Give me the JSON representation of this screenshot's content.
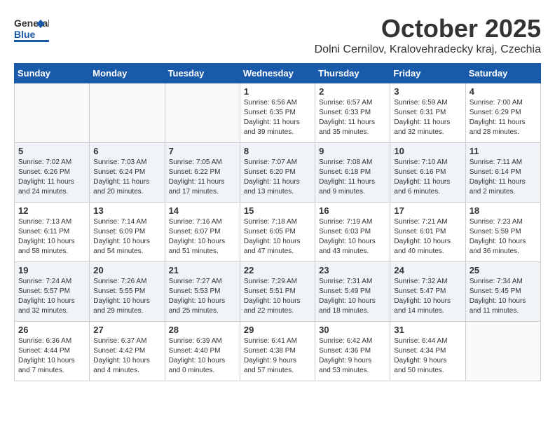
{
  "header": {
    "logo": {
      "general": "General",
      "blue": "Blue"
    },
    "title": "October 2025",
    "location": "Dolni Cernilov, Kralovehradecky kraj, Czechia"
  },
  "calendar": {
    "days_of_week": [
      "Sunday",
      "Monday",
      "Tuesday",
      "Wednesday",
      "Thursday",
      "Friday",
      "Saturday"
    ],
    "weeks": [
      [
        {
          "day": "",
          "info": ""
        },
        {
          "day": "",
          "info": ""
        },
        {
          "day": "",
          "info": ""
        },
        {
          "day": "1",
          "info": "Sunrise: 6:56 AM\nSunset: 6:35 PM\nDaylight: 11 hours\nand 39 minutes."
        },
        {
          "day": "2",
          "info": "Sunrise: 6:57 AM\nSunset: 6:33 PM\nDaylight: 11 hours\nand 35 minutes."
        },
        {
          "day": "3",
          "info": "Sunrise: 6:59 AM\nSunset: 6:31 PM\nDaylight: 11 hours\nand 32 minutes."
        },
        {
          "day": "4",
          "info": "Sunrise: 7:00 AM\nSunset: 6:29 PM\nDaylight: 11 hours\nand 28 minutes."
        }
      ],
      [
        {
          "day": "5",
          "info": "Sunrise: 7:02 AM\nSunset: 6:26 PM\nDaylight: 11 hours\nand 24 minutes."
        },
        {
          "day": "6",
          "info": "Sunrise: 7:03 AM\nSunset: 6:24 PM\nDaylight: 11 hours\nand 20 minutes."
        },
        {
          "day": "7",
          "info": "Sunrise: 7:05 AM\nSunset: 6:22 PM\nDaylight: 11 hours\nand 17 minutes."
        },
        {
          "day": "8",
          "info": "Sunrise: 7:07 AM\nSunset: 6:20 PM\nDaylight: 11 hours\nand 13 minutes."
        },
        {
          "day": "9",
          "info": "Sunrise: 7:08 AM\nSunset: 6:18 PM\nDaylight: 11 hours\nand 9 minutes."
        },
        {
          "day": "10",
          "info": "Sunrise: 7:10 AM\nSunset: 6:16 PM\nDaylight: 11 hours\nand 6 minutes."
        },
        {
          "day": "11",
          "info": "Sunrise: 7:11 AM\nSunset: 6:14 PM\nDaylight: 11 hours\nand 2 minutes."
        }
      ],
      [
        {
          "day": "12",
          "info": "Sunrise: 7:13 AM\nSunset: 6:11 PM\nDaylight: 10 hours\nand 58 minutes."
        },
        {
          "day": "13",
          "info": "Sunrise: 7:14 AM\nSunset: 6:09 PM\nDaylight: 10 hours\nand 54 minutes."
        },
        {
          "day": "14",
          "info": "Sunrise: 7:16 AM\nSunset: 6:07 PM\nDaylight: 10 hours\nand 51 minutes."
        },
        {
          "day": "15",
          "info": "Sunrise: 7:18 AM\nSunset: 6:05 PM\nDaylight: 10 hours\nand 47 minutes."
        },
        {
          "day": "16",
          "info": "Sunrise: 7:19 AM\nSunset: 6:03 PM\nDaylight: 10 hours\nand 43 minutes."
        },
        {
          "day": "17",
          "info": "Sunrise: 7:21 AM\nSunset: 6:01 PM\nDaylight: 10 hours\nand 40 minutes."
        },
        {
          "day": "18",
          "info": "Sunrise: 7:23 AM\nSunset: 5:59 PM\nDaylight: 10 hours\nand 36 minutes."
        }
      ],
      [
        {
          "day": "19",
          "info": "Sunrise: 7:24 AM\nSunset: 5:57 PM\nDaylight: 10 hours\nand 32 minutes."
        },
        {
          "day": "20",
          "info": "Sunrise: 7:26 AM\nSunset: 5:55 PM\nDaylight: 10 hours\nand 29 minutes."
        },
        {
          "day": "21",
          "info": "Sunrise: 7:27 AM\nSunset: 5:53 PM\nDaylight: 10 hours\nand 25 minutes."
        },
        {
          "day": "22",
          "info": "Sunrise: 7:29 AM\nSunset: 5:51 PM\nDaylight: 10 hours\nand 22 minutes."
        },
        {
          "day": "23",
          "info": "Sunrise: 7:31 AM\nSunset: 5:49 PM\nDaylight: 10 hours\nand 18 minutes."
        },
        {
          "day": "24",
          "info": "Sunrise: 7:32 AM\nSunset: 5:47 PM\nDaylight: 10 hours\nand 14 minutes."
        },
        {
          "day": "25",
          "info": "Sunrise: 7:34 AM\nSunset: 5:45 PM\nDaylight: 10 hours\nand 11 minutes."
        }
      ],
      [
        {
          "day": "26",
          "info": "Sunrise: 6:36 AM\nSunset: 4:44 PM\nDaylight: 10 hours\nand 7 minutes."
        },
        {
          "day": "27",
          "info": "Sunrise: 6:37 AM\nSunset: 4:42 PM\nDaylight: 10 hours\nand 4 minutes."
        },
        {
          "day": "28",
          "info": "Sunrise: 6:39 AM\nSunset: 4:40 PM\nDaylight: 10 hours\nand 0 minutes."
        },
        {
          "day": "29",
          "info": "Sunrise: 6:41 AM\nSunset: 4:38 PM\nDaylight: 9 hours\nand 57 minutes."
        },
        {
          "day": "30",
          "info": "Sunrise: 6:42 AM\nSunset: 4:36 PM\nDaylight: 9 hours\nand 53 minutes."
        },
        {
          "day": "31",
          "info": "Sunrise: 6:44 AM\nSunset: 4:34 PM\nDaylight: 9 hours\nand 50 minutes."
        },
        {
          "day": "",
          "info": ""
        }
      ]
    ]
  }
}
